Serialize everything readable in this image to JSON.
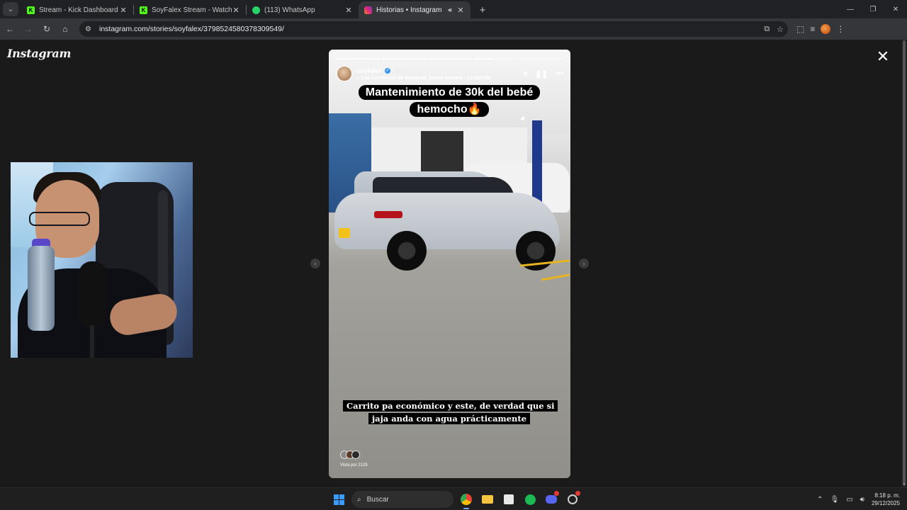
{
  "browser": {
    "tabs": [
      {
        "title": "Stream - Kick Dashboard",
        "favicon_color": "#53fc18",
        "favicon_icon": "kick-icon",
        "active": false
      },
      {
        "title": "SoyFalex Stream - Watch Live o",
        "favicon_color": "#53fc18",
        "favicon_icon": "kick-icon",
        "active": false
      },
      {
        "title": "(113) WhatsApp",
        "favicon_color": "#25d366",
        "favicon_icon": "whatsapp-icon",
        "active": false
      },
      {
        "title": "Historias • Instagram",
        "favicon_color": "#e1306c",
        "favicon_icon": "instagram-icon",
        "active": true
      }
    ],
    "url": "instagram.com/stories/soyfalex/3798524580378309549/"
  },
  "instagram": {
    "logo": "Instagram",
    "story": {
      "username": "soyfalex",
      "time": "4 h",
      "music": "Los Corraleros de Majagual, Eliseo Herrera · La Burrita",
      "caption_top": "Mantenimiento de 30k del bebé hemocho🔥",
      "caption_bottom": "Carrito pa económico y este, de verdad que si jaja anda con agua prácticamente",
      "viewed_by": "Vista por 2129",
      "segments_total": 5,
      "segments_completed": 3,
      "current_segment_progress": 0.4
    }
  },
  "taskbar": {
    "search_placeholder": "Buscar",
    "time": "8:18 p. m.",
    "date": "29/12/2025"
  },
  "colors": {
    "accent_blue": "#3797f0",
    "windows_blue": "#3b9cff"
  }
}
